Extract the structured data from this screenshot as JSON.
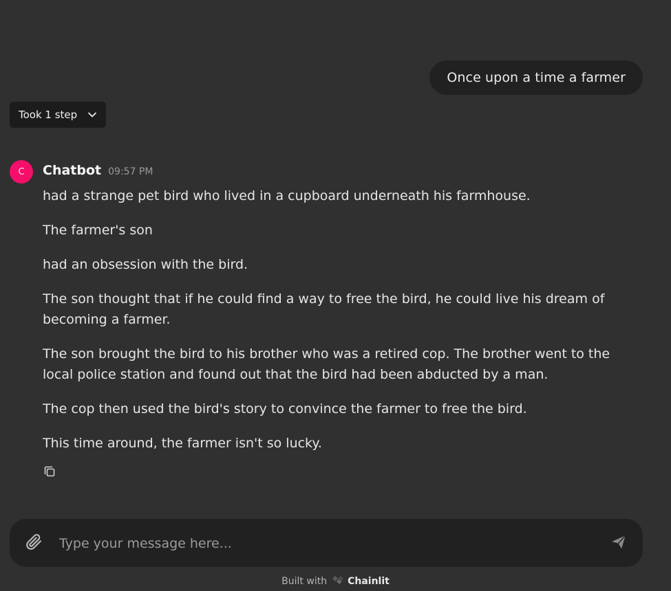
{
  "user_message": {
    "text": "Once upon a time a farmer"
  },
  "steps": {
    "label": "Took 1 step",
    "icon": "chevron-down-icon"
  },
  "bot": {
    "avatar_letter": "C",
    "avatar_color": "#f50f6a",
    "name": "Chatbot",
    "time": "09:57 PM",
    "paragraphs": [
      "had a strange pet bird who lived in a cupboard underneath his farmhouse.",
      "The farmer's son",
      "had an obsession with the bird.",
      "The son thought that if he could find a way to free the bird, he could live his dream of becoming a farmer.",
      "The son brought the bird to his brother who was a retired cop. The brother went to the local police station and found out that the bird had been abducted by a man.",
      "The cop then used the bird's story to convince the farmer to free the bird.",
      "This time around, the farmer isn't so lucky."
    ],
    "copy_icon": "copy-icon"
  },
  "composer": {
    "placeholder": "Type your message here...",
    "value": "",
    "attach_icon": "paperclip-icon",
    "send_icon": "send-icon"
  },
  "footer": {
    "built_with": "Built with",
    "brand": "Chainlit"
  },
  "colors": {
    "background": "#303030",
    "bubble": "#212121",
    "accent": "#f50f6a"
  }
}
